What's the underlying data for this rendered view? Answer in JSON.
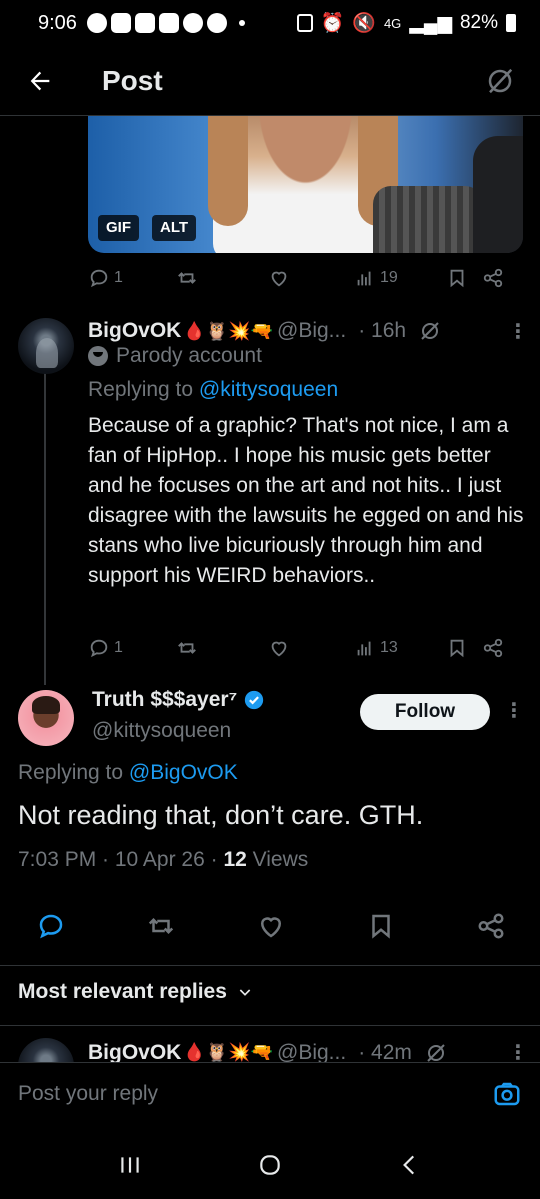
{
  "status_bar": {
    "time": "9:06",
    "network": "4G",
    "battery": "82%"
  },
  "header": {
    "title": "Post",
    "back_icon": "arrow-left-icon",
    "grok_icon": "grok-icon"
  },
  "media": {
    "gif_label": "GIF",
    "alt_label": "ALT"
  },
  "top_post_actions": {
    "replies": "1",
    "reposts": "",
    "likes": "",
    "views": "19"
  },
  "reply": {
    "name": "BigOvOK",
    "emojis": "🩸🦉💥🔫",
    "handle": "@Big...",
    "time": "· 16h",
    "parody_label": "Parody account",
    "replying_prefix": "Replying to ",
    "replying_to": "@kittysoqueen",
    "body": "Because of a graphic? That's not nice, I am a fan of HipHop.. I hope his music gets better and he focuses on the art and not hits.. I just disagree with the lawsuits he egged on and his stans who live bicuriously through him and support his WEIRD behaviors..",
    "actions": {
      "replies": "1",
      "views": "13"
    }
  },
  "main_post": {
    "name": "Truth $$$ayer⁷",
    "handle": "@kittysoqueen",
    "follow_label": "Follow",
    "replying_prefix": "Replying to ",
    "replying_to": "@BigOvOK",
    "text": "Not reading that, don’t care. GTH.",
    "time": "7:03 PM · 10 Apr 26 · ",
    "views_count": "12",
    "views_label": " Views"
  },
  "relevant": {
    "label": "Most relevant replies"
  },
  "next_reply": {
    "name": "BigOvOK",
    "emojis": "🩸🦉💥🔫",
    "handle": "@Big...",
    "time": "· 42m"
  },
  "reply_bar": {
    "placeholder": "Post your reply"
  },
  "colors": {
    "background": "#000000",
    "text": "#e7e9ea",
    "muted": "#71767b",
    "accent": "#1d9bf0",
    "divider": "#2f3336"
  }
}
